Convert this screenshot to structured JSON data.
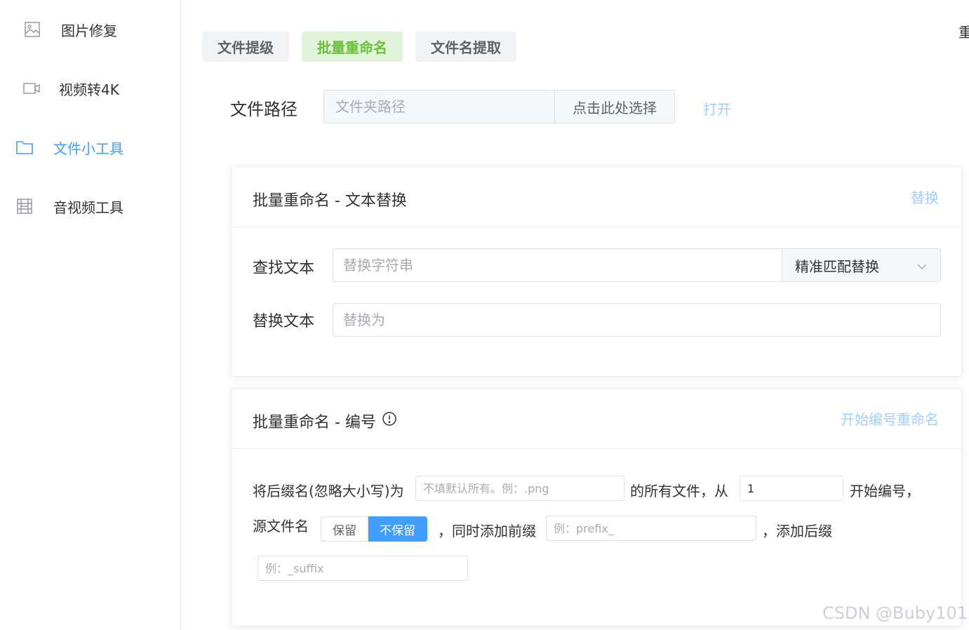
{
  "sidebar": {
    "items": [
      {
        "label": "图片修复",
        "icon": "image-icon"
      },
      {
        "label": "视频转4K",
        "icon": "video-icon"
      },
      {
        "label": "文件小工具",
        "icon": "folder-icon",
        "active": true
      },
      {
        "label": "音视频工具",
        "icon": "film-icon"
      }
    ]
  },
  "tabs": [
    {
      "label": "文件提级"
    },
    {
      "label": "批量重命名",
      "active": true
    },
    {
      "label": "文件名提取"
    }
  ],
  "topright_text": "重",
  "path": {
    "label": "文件路径",
    "placeholder": "文件夹路径",
    "choose_button": "点击此处选择",
    "open_link": "打开"
  },
  "replace_card": {
    "title": "批量重命名 - 文本替换",
    "action": "替换",
    "find_label": "查找文本",
    "find_placeholder": "替换字符串",
    "match_mode": "精准匹配替换",
    "replace_label": "替换文本",
    "replace_placeholder": "替换为"
  },
  "number_card": {
    "title": "批量重命名 - 编号",
    "action": "开始编号重命名",
    "text_suffix_prefix": "将后缀名(忽略大小写)为",
    "suffix_placeholder": "不填默认所有。例：.png",
    "text_all_files_from": "的所有文件，从",
    "start_value": "1",
    "text_start_numbering": "开始编号，",
    "text_source_filename": "源文件名",
    "keep_option": "保留",
    "no_keep_option": "不保留",
    "text_add_prefix": "，同时添加前缀",
    "prefix_placeholder": "例：prefix_",
    "text_add_suffix": "，添加后缀",
    "suffix2_placeholder": "例：_suffix"
  },
  "watermark": "CSDN @Buby101",
  "colors": {
    "accent": "#409eff",
    "accent_light": "#a0cfff",
    "success": "#67c23a",
    "success_bg": "#e1f3d8"
  }
}
